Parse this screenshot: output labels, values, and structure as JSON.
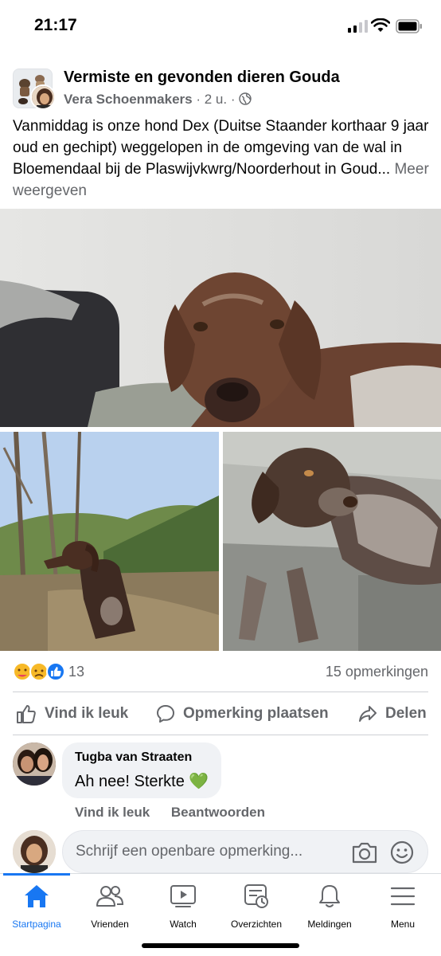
{
  "status_bar": {
    "time": "21:17",
    "icons": [
      "cellular-signal-icon",
      "wifi-icon",
      "battery-icon"
    ]
  },
  "post": {
    "group_name": "Vermiste en gevonden dieren Gouda",
    "author": "Vera Schoenmakers",
    "time": "2 u.",
    "separator": "·",
    "audience_icon": "globe-icon",
    "text": "Vanmiddag is onze hond Dex (Duitse Staander korthaar 9 jaar oud en gechipt) weggelopen in de omgeving van de wal in Bloemendaal bij de Plaswijvkwrg/Noorderhout in Goud...",
    "see_more": "Meer weergeven"
  },
  "reactions": {
    "icons": [
      "care-reaction-icon",
      "sad-reaction-icon",
      "like-reaction-icon"
    ],
    "count": "13",
    "comments": "15 opmerkingen"
  },
  "actions": {
    "like": "Vind ik leuk",
    "comment": "Opmerking plaatsen",
    "share": "Delen"
  },
  "comment": {
    "author": "Tugba van Straaten",
    "text": "Ah nee! Sterkte 💚",
    "like": "Vind ik leuk",
    "reply": "Beantwoorden"
  },
  "composer": {
    "placeholder": "Schrijf een openbare opmerking..."
  },
  "tabs": [
    {
      "label": "Startpagina",
      "icon": "home-icon",
      "active": true
    },
    {
      "label": "Vrienden",
      "icon": "friends-icon",
      "active": false
    },
    {
      "label": "Watch",
      "icon": "watch-icon",
      "active": false
    },
    {
      "label": "Overzichten",
      "icon": "feeds-icon",
      "active": false
    },
    {
      "label": "Meldingen",
      "icon": "bell-icon",
      "active": false
    },
    {
      "label": "Menu",
      "icon": "menu-icon",
      "active": false
    }
  ],
  "colors": {
    "accent": "#1877f2",
    "secondary_text": "#65676b",
    "bubble": "#f0f2f5"
  }
}
